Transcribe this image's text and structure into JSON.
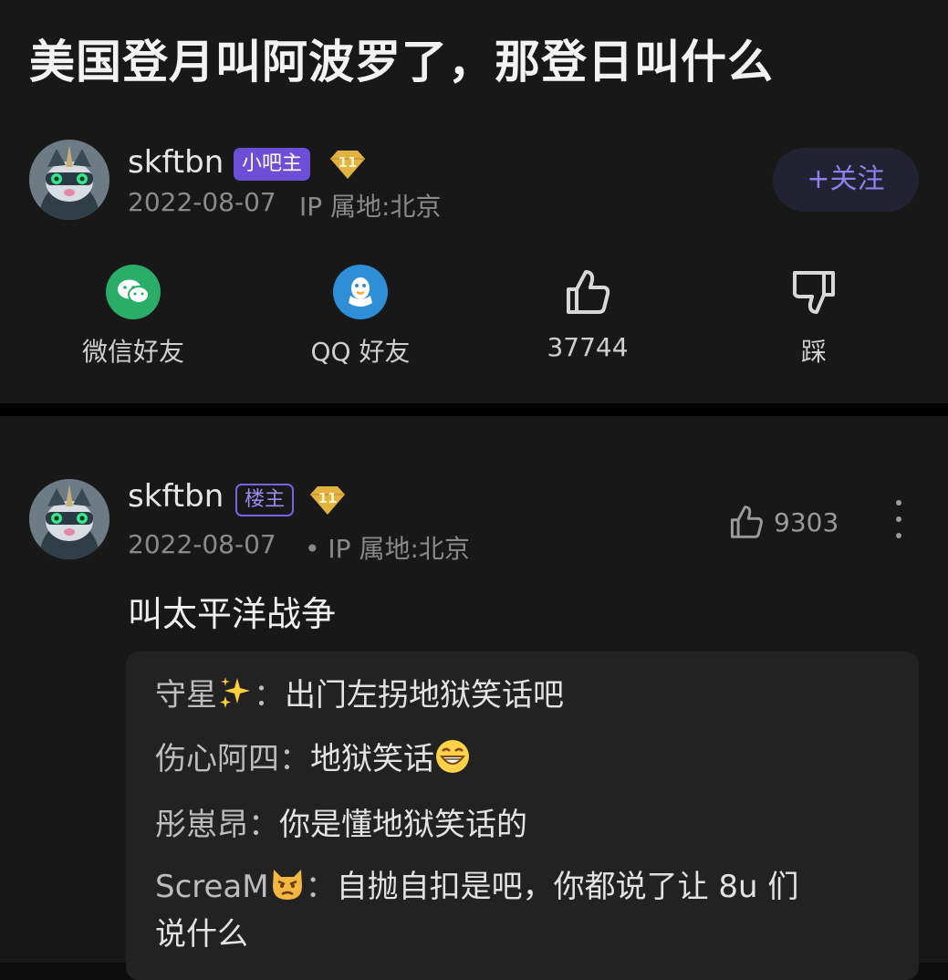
{
  "post": {
    "title": "美国登月叫阿波罗了，那登日叫什么",
    "author": {
      "name": "skftbn",
      "role_badge": "小吧主",
      "level": "11",
      "date": "2022-08-07",
      "ip": "IP 属地:北京"
    },
    "follow_label": "+关注"
  },
  "actions": {
    "wechat": "微信好友",
    "qq": "QQ 好友",
    "like_count": "37744",
    "dislike": "踩"
  },
  "floor": {
    "author": {
      "name": "skftbn",
      "role_badge": "楼主",
      "level": "11",
      "date": "2022-08-07",
      "ip": "• IP 属地:北京"
    },
    "like_count": "9303",
    "body": "叫太平洋战争",
    "replies": [
      {
        "name": "守星",
        "emoji": "sparkles",
        "sep": "：",
        "text": "出门左拐地狱笑话吧"
      },
      {
        "name": "伤心阿四：",
        "text": "地狱笑话",
        "emoji": "grin-face"
      },
      {
        "name": "彤崽昂：",
        "text": "你是懂地狱笑话的"
      },
      {
        "name": "ScreaM",
        "emoji": "angry-cat",
        "sep": "：",
        "text": "自抛自扣是吧，你都说了让 8u 们",
        "text2": "说什么"
      }
    ]
  },
  "colors": {
    "accent": "#7a62e0",
    "wechat": "#2aae67",
    "qq": "#2f8fd6",
    "level_gold": "#e3b341"
  }
}
